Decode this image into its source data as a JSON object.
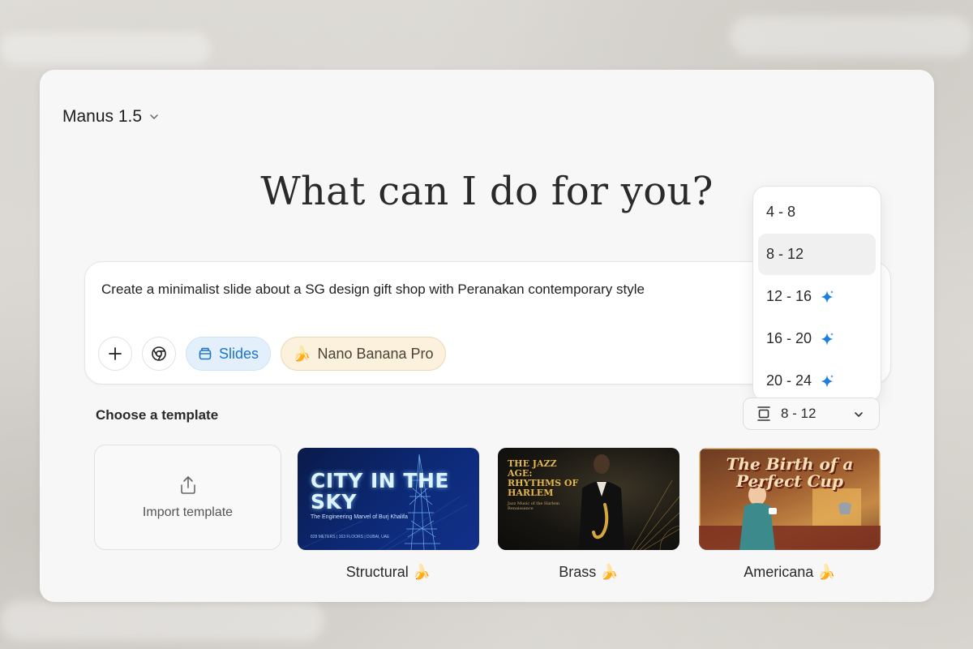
{
  "header": {
    "model_label": "Manus 1.5"
  },
  "hero": {
    "title": "What can I do for you?"
  },
  "composer": {
    "prompt": "Create a minimalist slide about a SG design gift shop with Peranakan contemporary style",
    "chips": {
      "slides_label": "Slides",
      "banana_label": "Nano Banana Pro",
      "banana_emoji": "🍌"
    }
  },
  "slide_count_dropdown": {
    "options": [
      {
        "label": "4 - 8",
        "premium": false
      },
      {
        "label": "8 - 12",
        "premium": false,
        "selected": true
      },
      {
        "label": "12 - 16",
        "premium": true
      },
      {
        "label": "16 - 20",
        "premium": true
      },
      {
        "label": "20 - 24",
        "premium": true
      }
    ],
    "current_value": "8 - 12"
  },
  "templates": {
    "section_label": "Choose a template",
    "import_label": "Import template",
    "items": [
      {
        "caption": "Structural 🍌",
        "thumb_title": "CITY IN THE SKY",
        "thumb_subtitle": "The Engineering Marvel of Burj Khalifa",
        "thumb_footer": "828 METERS | 163 FLOORS | DUBAI, UAE"
      },
      {
        "caption": "Brass 🍌",
        "thumb_title": "THE JAZZ AGE: RHYTHMS OF HARLEM",
        "thumb_subtitle": "Jazz Music of the Harlem Renaissance"
      },
      {
        "caption": "Americana 🍌",
        "thumb_title": "The Birth of a Perfect Cup"
      }
    ]
  },
  "colors": {
    "accent_blue": "#1b74c8",
    "sparkle_blue": "#1f7fe0"
  }
}
